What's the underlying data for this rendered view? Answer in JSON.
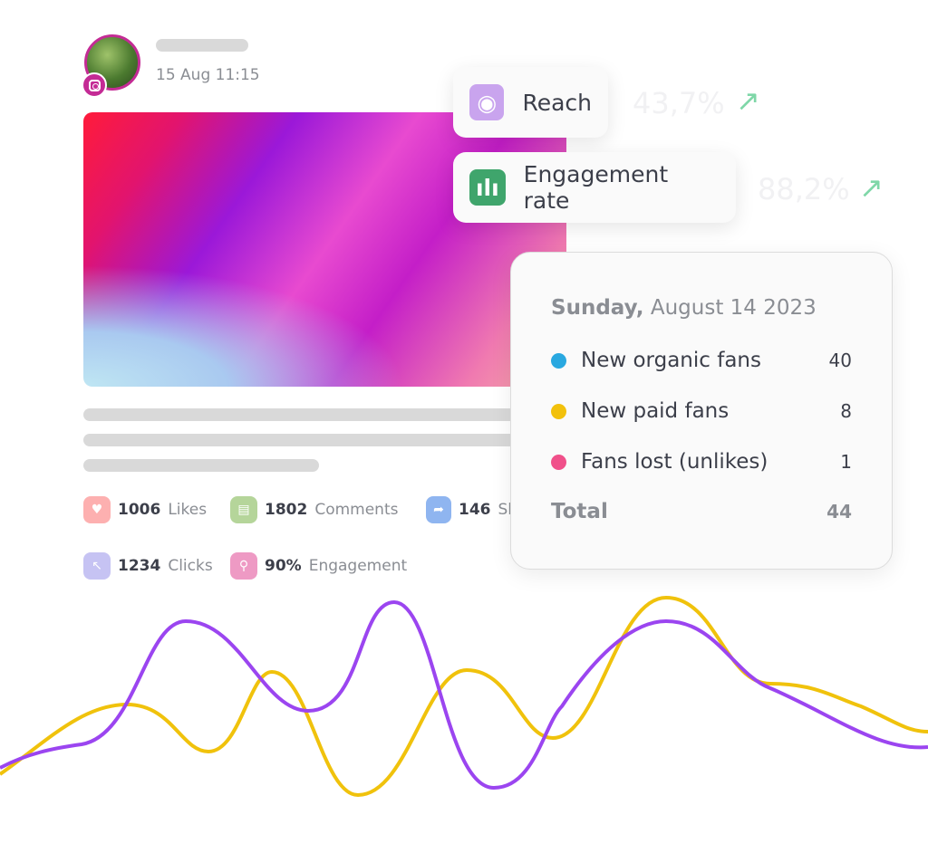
{
  "post": {
    "date": "15 Aug 11:15",
    "platform_icon": "instagram-icon"
  },
  "stats": [
    {
      "value": "1006",
      "label": "Likes",
      "icon": "heart-icon",
      "color": "#fdb0b0"
    },
    {
      "value": "1802",
      "label": "Comments",
      "icon": "comment-icon",
      "color": "#b5d59a"
    },
    {
      "value": "146",
      "label": "Sl",
      "icon": "share-icon",
      "color": "#8fb5f0"
    },
    {
      "value": "1234",
      "label": "Clicks",
      "icon": "cursor-click-icon",
      "color": "#c6c3f3"
    },
    {
      "value": "90%",
      "label": "Engagement",
      "icon": "engagement-icon",
      "color": "#ee9ac4"
    }
  ],
  "metrics": [
    {
      "label": "Reach",
      "value": "43,7%",
      "icon": "eye-icon",
      "color": "#c9a4ee",
      "trend": "up"
    },
    {
      "label": "Engagement rate",
      "value": "88,2%",
      "icon": "bar-chart-icon",
      "color": "#3fa56c",
      "trend": "up"
    }
  ],
  "tooltip": {
    "day": "Sunday,",
    "date": "August 14  2023",
    "rows": [
      {
        "label": "New organic fans",
        "value": "40",
        "color": "#29a8e0"
      },
      {
        "label": "New paid fans",
        "value": "8",
        "color": "#f2c10c"
      },
      {
        "label": "Fans lost (unlikes)",
        "value": "1",
        "color": "#f0508a"
      }
    ],
    "total_label": "Total",
    "total_value": "44"
  },
  "waves": {
    "colors": [
      "#9b45f0",
      "#f0c20c"
    ]
  }
}
